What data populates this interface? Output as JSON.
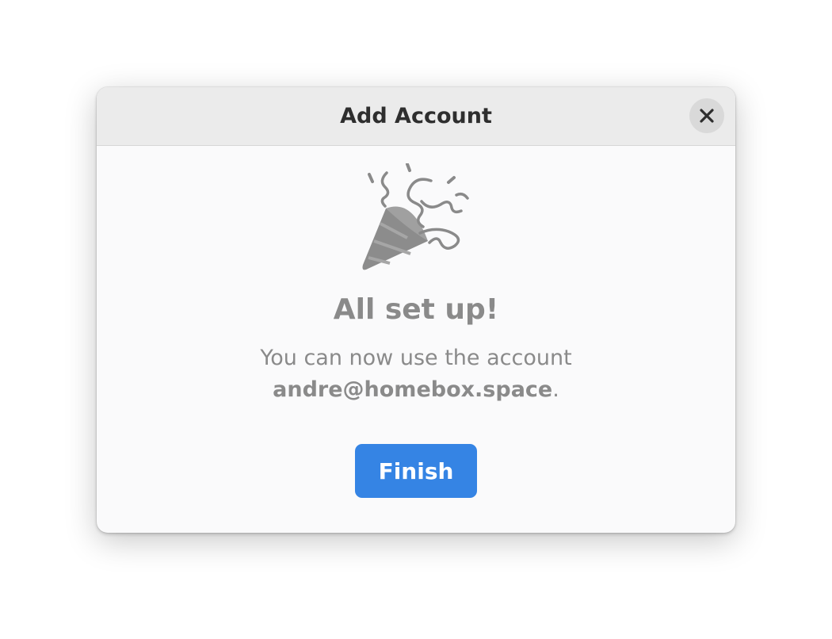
{
  "dialog": {
    "title": "Add Account",
    "close_icon": "close-icon"
  },
  "content": {
    "illustration_icon": "party-popper-icon",
    "heading": "All set up!",
    "message_prefix": "You can now use the account",
    "account": "andre@homebox.space",
    "message_suffix": ".",
    "finish_label": "Finish"
  },
  "colors": {
    "accent": "#3584e4",
    "header_bg": "#ebebeb",
    "body_bg": "#fafafb",
    "muted_text": "#8a8a8a"
  }
}
